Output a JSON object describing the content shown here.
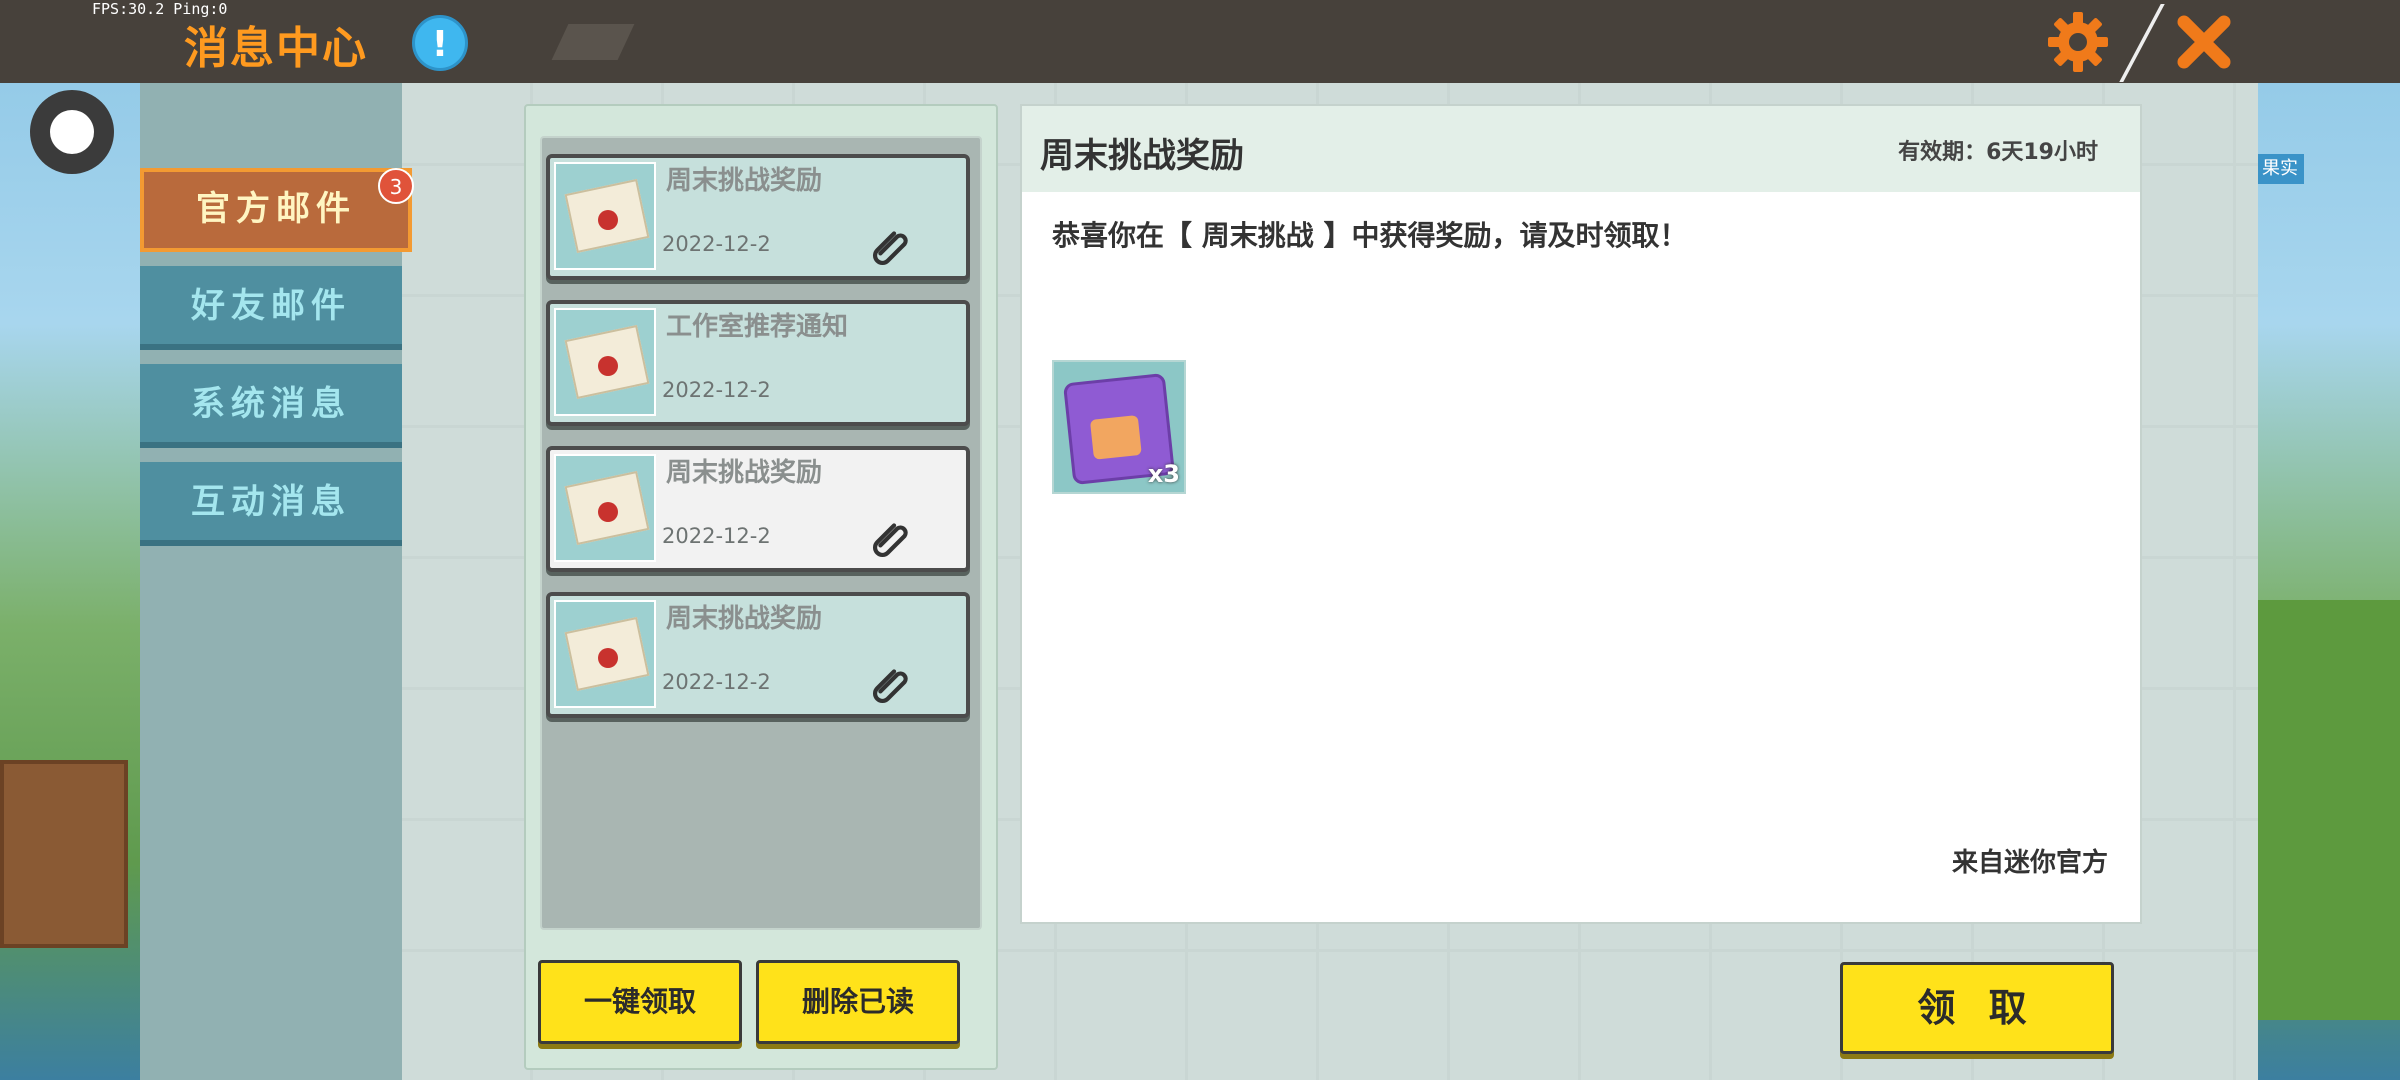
{
  "status_overlay": {
    "fps_text": "FPS:30.2  Ping:0"
  },
  "header": {
    "title": "消息中心",
    "info_glyph": "!",
    "icons": [
      "info-icon",
      "gear-icon",
      "close-icon"
    ]
  },
  "sidebar": {
    "items": [
      {
        "label": "官方邮件",
        "active": true,
        "badge": "3"
      },
      {
        "label": "好友邮件",
        "active": false
      },
      {
        "label": "系统消息",
        "active": false
      },
      {
        "label": "互动消息",
        "active": false
      }
    ]
  },
  "mail_list": [
    {
      "title": "周末挑战奖励",
      "date": "2022-12-2",
      "has_attachment": true,
      "selected": false
    },
    {
      "title": "工作室推荐通知",
      "date": "2022-12-2",
      "has_attachment": false,
      "selected": false
    },
    {
      "title": "周末挑战奖励",
      "date": "2022-12-2",
      "has_attachment": true,
      "selected": true
    },
    {
      "title": "周末挑战奖励",
      "date": "2022-12-2",
      "has_attachment": true,
      "selected": false
    }
  ],
  "list_actions": {
    "claim_all": "一键领取",
    "delete_read": "删除已读"
  },
  "detail": {
    "title": "周末挑战奖励",
    "expiry": "有效期：6天19小时",
    "body": "恭喜你在【 周末挑战 】中获得奖励，请及时领取！",
    "reward": {
      "item": "gift-box",
      "quantity": "x3"
    },
    "sender": "来自迷你官方",
    "claim_button": "领 取"
  },
  "game_overlay": {
    "edge_label": "果实"
  },
  "colors": {
    "topbar": "#47413b",
    "title": "#ff9a1f",
    "accent_yellow": "#ffe21a",
    "sidebar_tab": "#4f8fa0",
    "sidebar_active": "#b96a3c",
    "badge": "#e0533a"
  }
}
